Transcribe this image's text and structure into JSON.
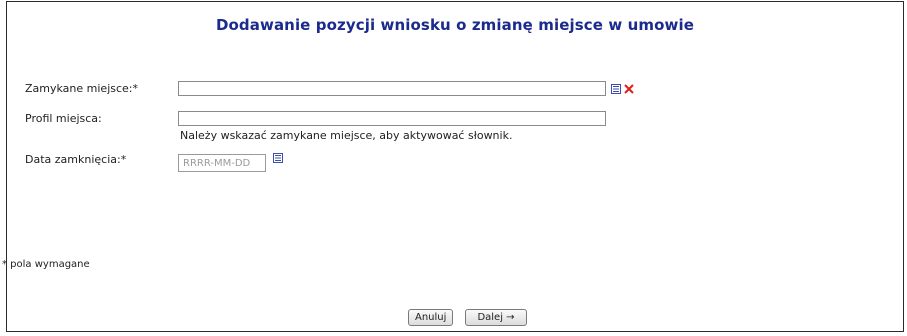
{
  "page": {
    "title": "Dodawanie pozycji wniosku o zmianę miejsce w umowie"
  },
  "form": {
    "closed_place": {
      "label": "Zamykane miejsce:*",
      "value": "",
      "list_icon": "list-icon",
      "clear_icon": "clear-x-icon"
    },
    "place_profile": {
      "label": "Profil miejsca:",
      "value": "",
      "hint": "Należy wskazać zamykane miejsce, aby aktywować słownik."
    },
    "close_date": {
      "label": "Data zamknięcia:*",
      "placeholder": "RRRR-MM-DD",
      "calendar_icon": "list-icon"
    }
  },
  "footer": {
    "required_note": "* pola wymagane",
    "cancel_label": "Anuluj",
    "next_label": "Dalej →"
  },
  "colors": {
    "title": "#1b2a8c",
    "icon_blue": "#3b4fb0",
    "clear_red": "#e0201c"
  }
}
